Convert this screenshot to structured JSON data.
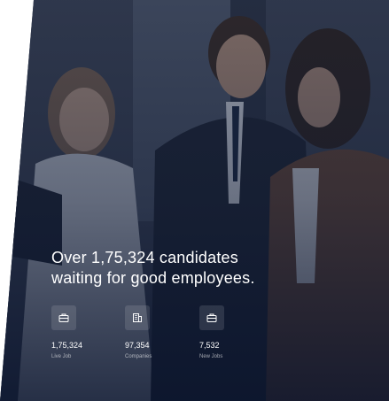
{
  "hero": {
    "headline_line1": "Over 1,75,324 candidates",
    "headline_line2": "waiting for good employees."
  },
  "stats": [
    {
      "value": "1,75,324",
      "label": "Live Job",
      "icon": "briefcase-icon"
    },
    {
      "value": "97,354",
      "label": "Companies",
      "icon": "building-icon"
    },
    {
      "value": "7,532",
      "label": "New Jobs",
      "icon": "briefcase-icon"
    }
  ],
  "colors": {
    "overlay": "#0f1a33",
    "text": "#ffffff",
    "icon_bg": "#3a4660"
  }
}
